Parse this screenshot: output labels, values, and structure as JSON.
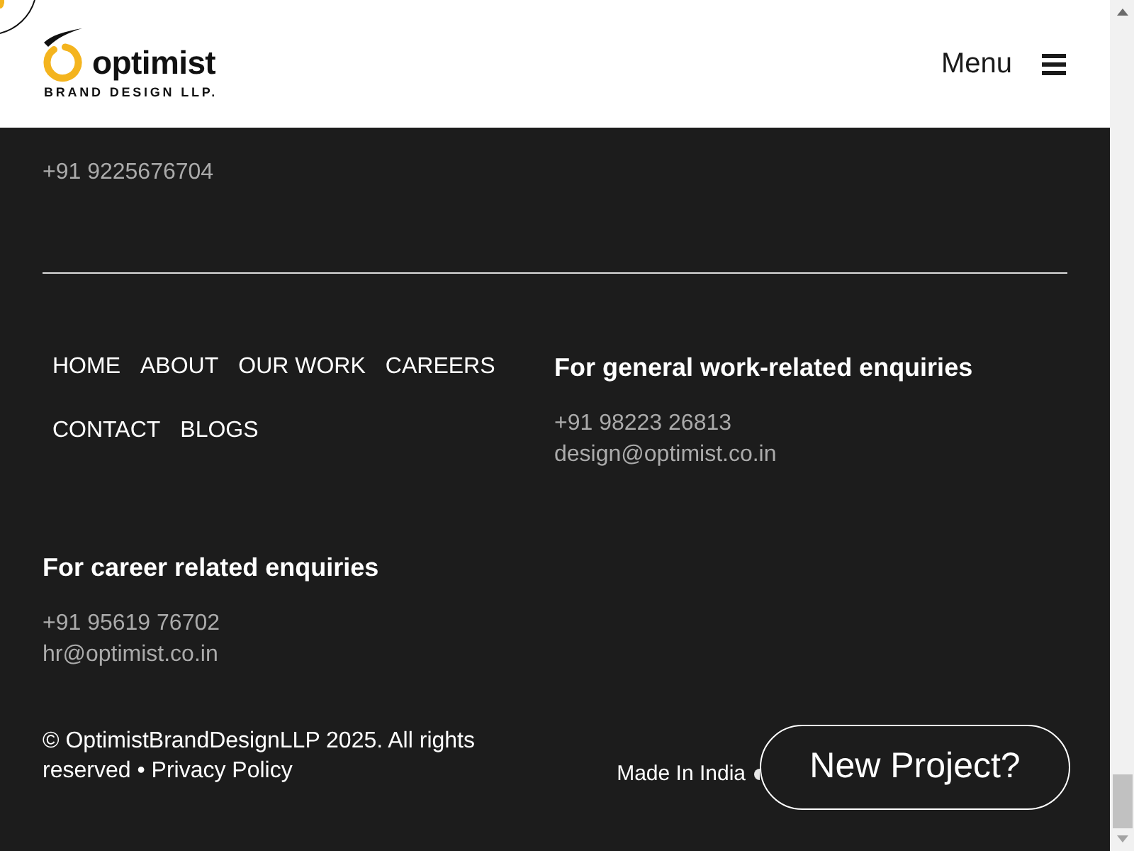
{
  "header": {
    "logo": {
      "wordmark": "optimist",
      "tagline": "BRAND DESIGN LLP."
    },
    "menu": {
      "label": "Menu"
    }
  },
  "office": {
    "phone": "+91 9225676704"
  },
  "nav_links": [
    "HOME",
    "ABOUT",
    "OUR WORK",
    "CAREERS",
    "CONTACT",
    "BLOGS"
  ],
  "general_enquiries": {
    "heading": "For general work-related enquiries",
    "phone": "+91 98223 26813",
    "email": "design@optimist.co.in"
  },
  "career_enquiries": {
    "heading": "For career related enquiries",
    "phone": "+91 95619 76702",
    "email": "hr@optimist.co.in"
  },
  "footer": {
    "copyright": "© OptimistBrandDesignLLP 2025. All rights reserved",
    "separator": "•",
    "privacy_link": "Privacy Policy",
    "made_in": "Made In India",
    "cta_button": "New Project?"
  }
}
